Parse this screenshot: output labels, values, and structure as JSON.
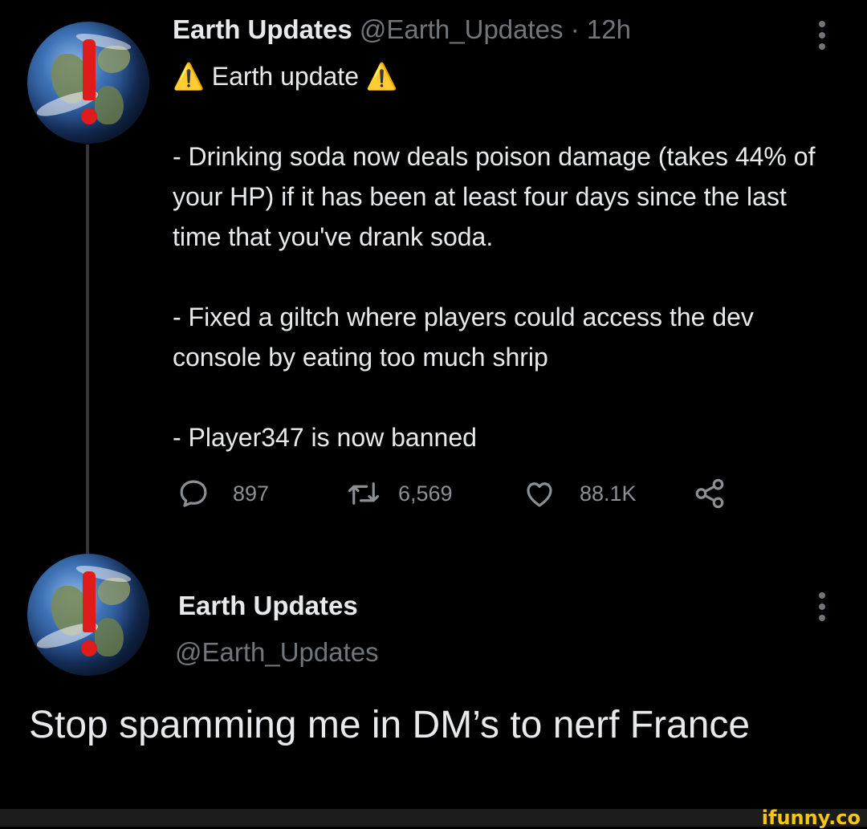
{
  "tweet": {
    "author_name": "Earth Updates",
    "author_handle": "@Earth_Updates",
    "separator": "·",
    "time": "12h",
    "line1": "⚠️ Earth update ⚠️",
    "paragraphs": [
      "- Drinking soda now deals poison damage (takes 44% of your HP) if it has been at least four days since the last time that you've drank soda.",
      "- Fixed a giltch where players could access the dev console by eating too much shrip",
      "- Player347 is now banned"
    ],
    "replies": "897",
    "retweets": "6,569",
    "likes": "88.1K"
  },
  "reply": {
    "author_name": "Earth Updates",
    "author_handle": "@Earth_Updates",
    "text": "Stop spamming me in DM’s to nerf France"
  },
  "watermark": "ifunny.co",
  "icons": [
    "reply-icon",
    "retweet-icon",
    "like-icon",
    "share-icon",
    "more-icon"
  ],
  "colors": {
    "background": "#000000",
    "text": "#e7e9ea",
    "muted": "#71767b",
    "warning": "#f5c518",
    "avatar_mark": "#e01b1b"
  }
}
